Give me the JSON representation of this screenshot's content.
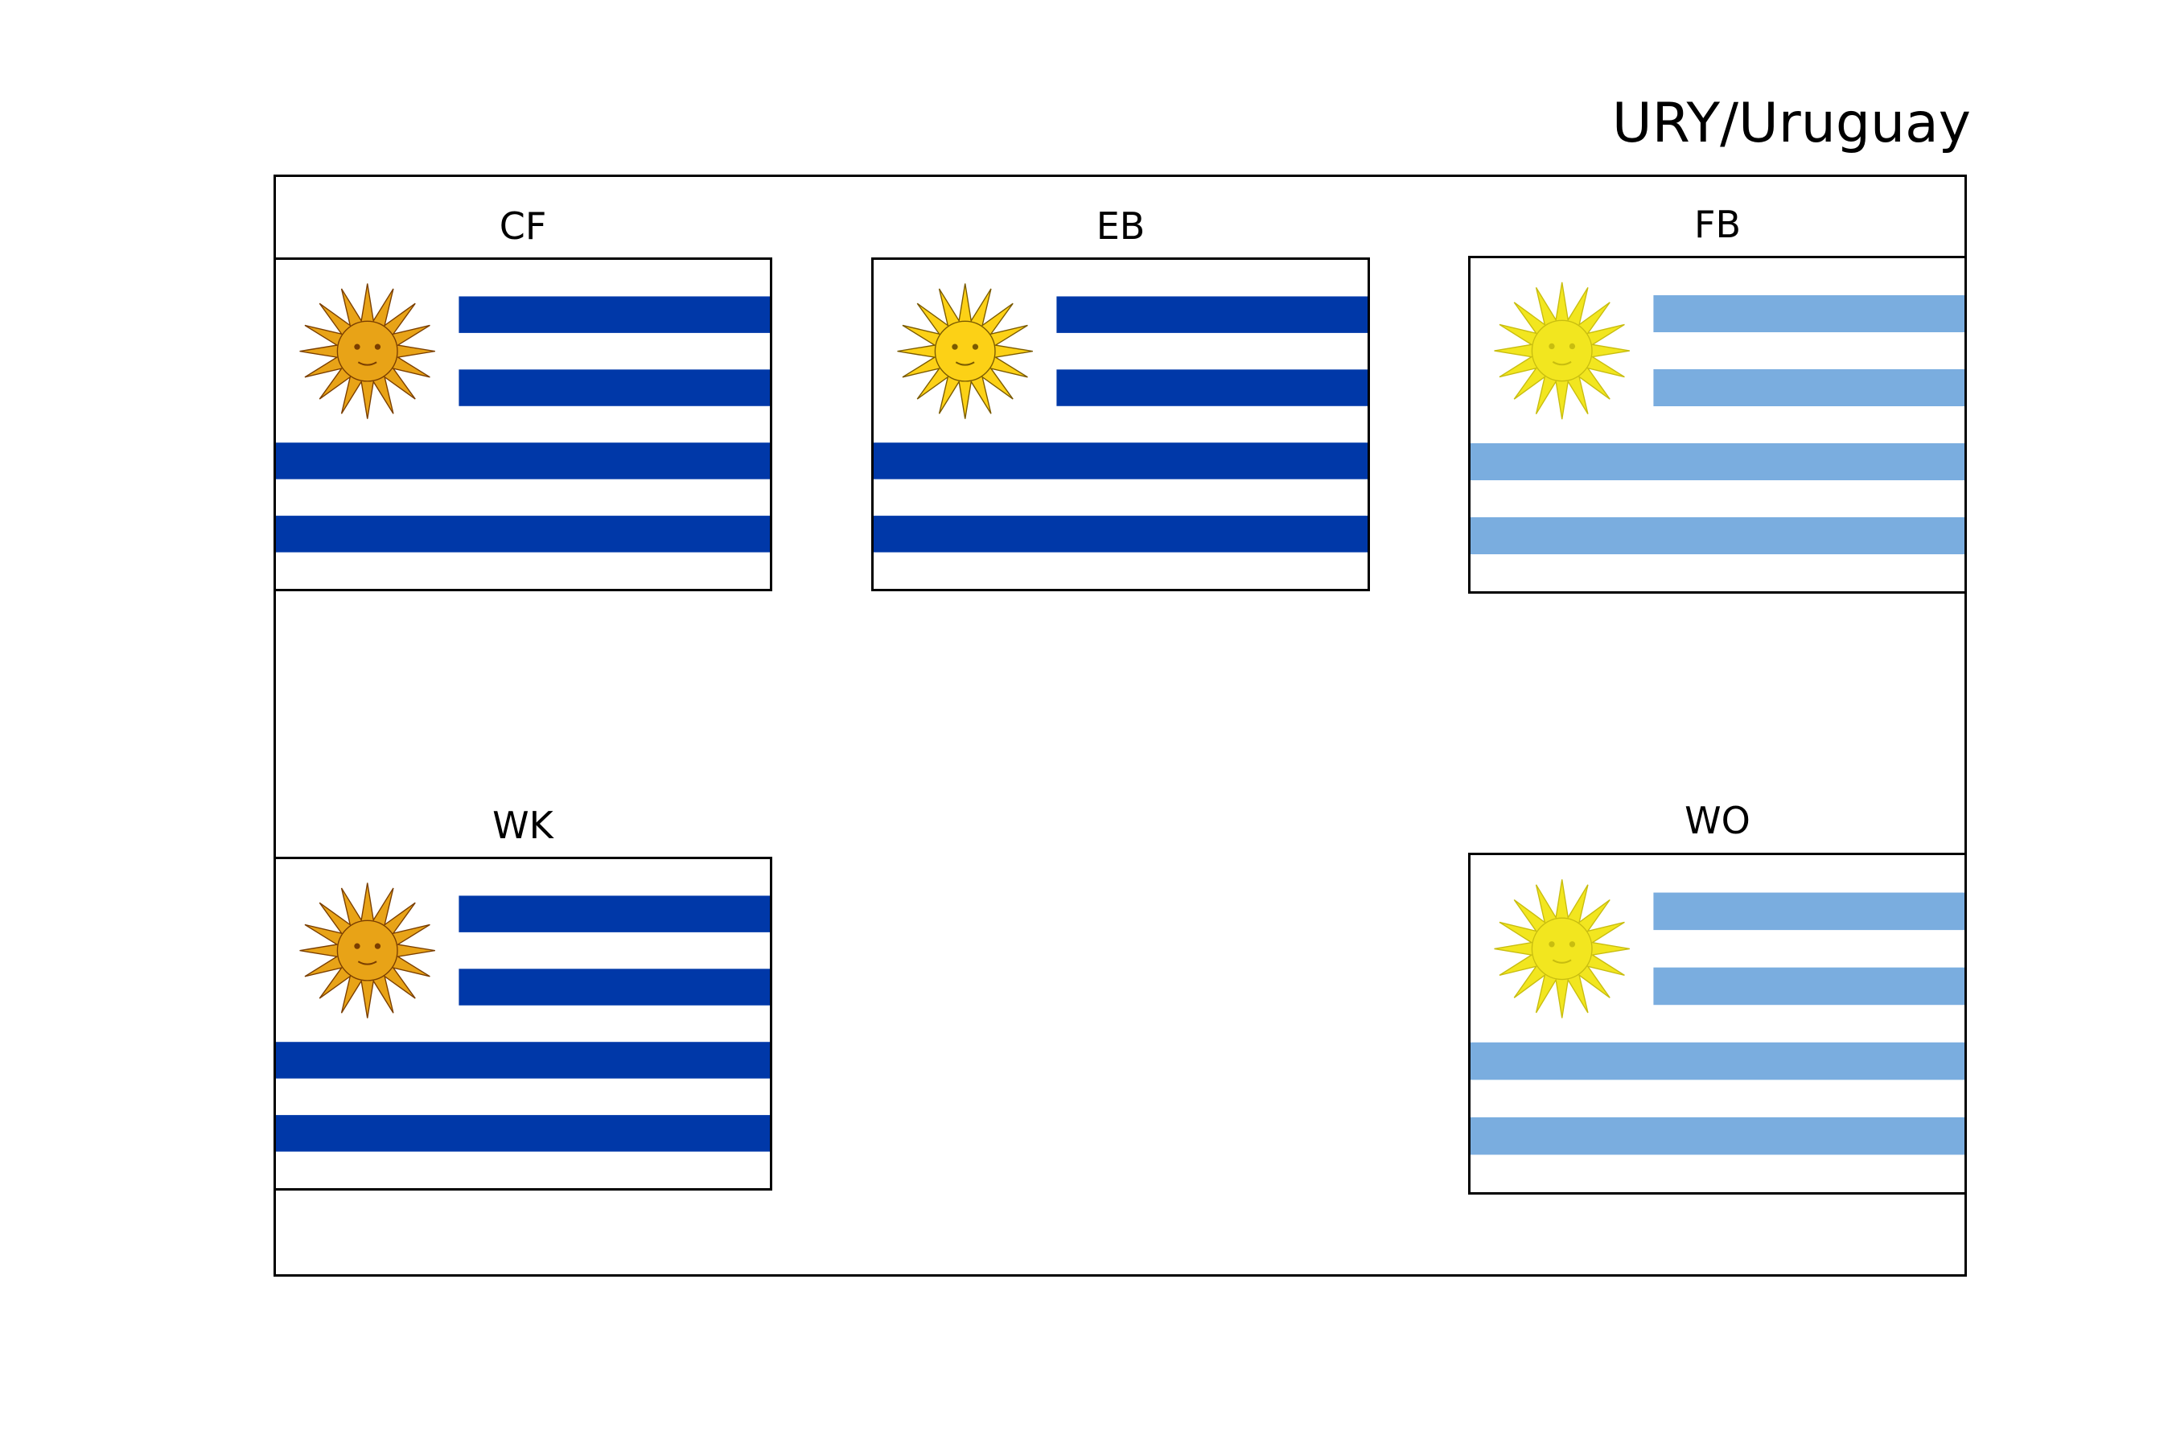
{
  "title": "URY/Uruguay",
  "flags": [
    {
      "label": "CF",
      "stripe_color": "#0038a8",
      "sun_fill": "#e8a317",
      "sun_stroke": "#7a3e00"
    },
    {
      "label": "EB",
      "stripe_color": "#0038a8",
      "sun_fill": "#fcd116",
      "sun_stroke": "#7a5a00"
    },
    {
      "label": "FB",
      "stripe_color": "#7aaddf",
      "sun_fill": "#f2e61f",
      "sun_stroke": "#c8bd10"
    },
    {
      "label": "WK",
      "stripe_color": "#0038a8",
      "sun_fill": "#e8a317",
      "sun_stroke": "#7a3e00"
    },
    {
      "label": "WO",
      "stripe_color": "#7aaddf",
      "sun_fill": "#f2e61f",
      "sun_stroke": "#c8bd10"
    }
  ]
}
